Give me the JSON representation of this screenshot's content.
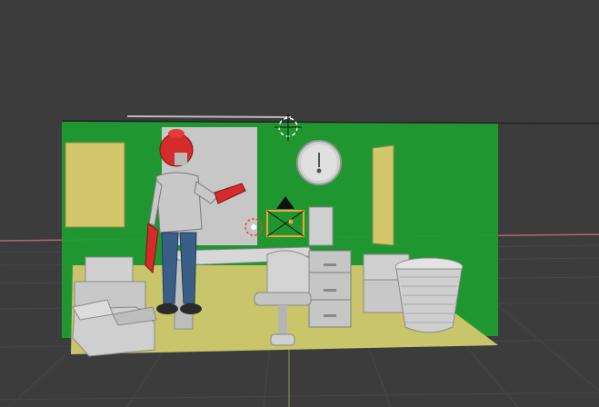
{
  "app": {
    "name": "3D viewport",
    "view_mode": "perspective",
    "shading": "solid"
  },
  "colors": {
    "background": "#3c3c3c",
    "grid_line": "#474747",
    "grid_line_alt": "#2f2f2f",
    "x_axis": "#b06b6b",
    "y_axis": "#7fa15b",
    "room_wall": "#1f9b2f",
    "room_floor": "#c9c56a",
    "selection_outline": "#f0a53a",
    "character_head": "#d62b2b",
    "character_shirt": "#c8c8c8",
    "character_pants": "#3a5f86",
    "object_gray": "#c9c9c9"
  },
  "scene": {
    "objects": [
      "room",
      "left-door",
      "right-door",
      "back-door-panel",
      "wall-clock",
      "robot-character",
      "office-desk",
      "office-chair",
      "filing-cabinet",
      "cardboard-boxes",
      "wastebasket",
      "camera",
      "light-empty"
    ]
  },
  "icons": {
    "camera": "camera-icon",
    "light": "light-icon",
    "origin": "origin-icon"
  }
}
